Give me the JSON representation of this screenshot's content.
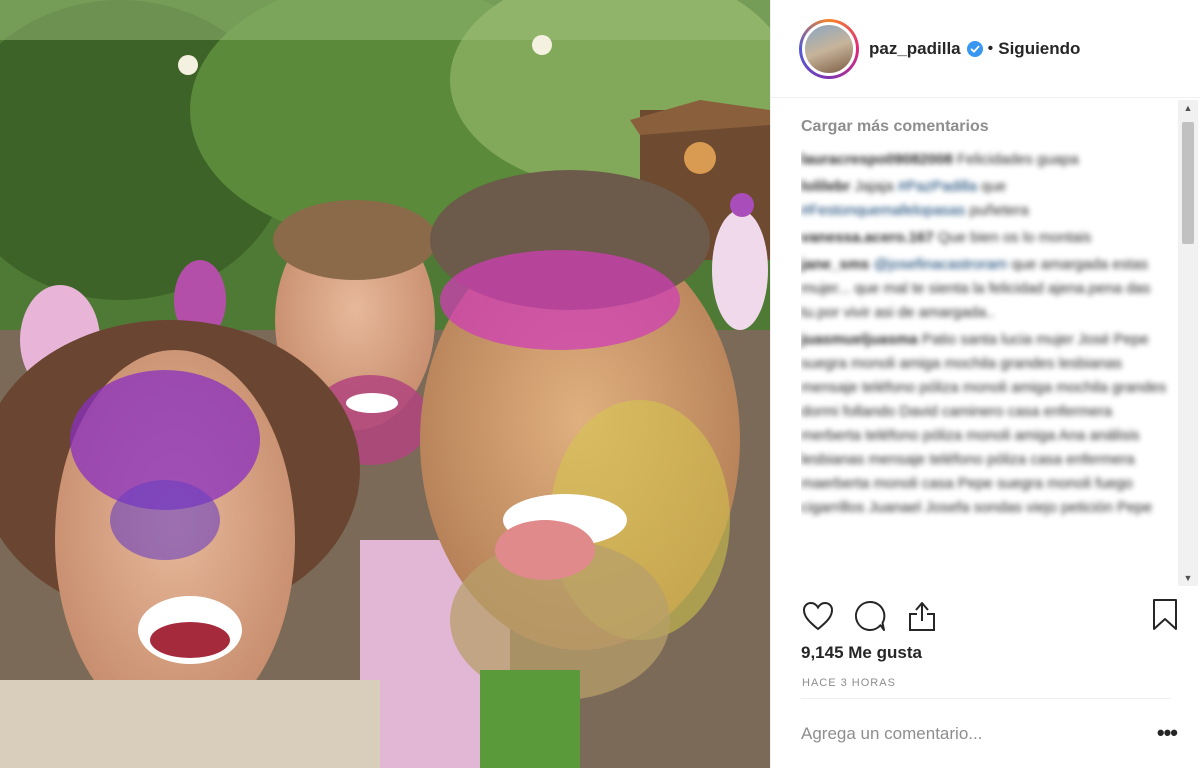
{
  "post": {
    "username": "paz_padilla",
    "separator": "•",
    "follow_state": "Siguiendo"
  },
  "comments_section": {
    "load_more_label": "Cargar más comentarios",
    "comments": [
      {
        "user": "lauracrespo09082008",
        "text": "Felicidades guapa"
      },
      {
        "user": "lolilebr",
        "text": "Jajaja",
        "tag1": "#PazPadilla",
        "text2": "que",
        "tag2": "#Festonquemafelopasas",
        "text3": "puñetera"
      },
      {
        "user": "vanessa.acero.167",
        "text": "Que bien os lo montais"
      },
      {
        "user": "jane_sms",
        "tag1": "@josefinacastroram",
        "text": "que amargada estas mujer... que mal te sienta la felicidad ajena.pena das tu.por vivir asi de amargada.."
      },
      {
        "user": "juasmueljuasma",
        "text": "Patio santa lucia mujer José Pepe suegra monoli amiga mochila grandes lesbianas mensaje teléfono póliza monoli amiga mochila grandes dormi follando David caminero casa enfermera merberta teléfono póliza monoli amiga Ana análisis lesbianas mensaje teléfono póliza casa enfermera maerberta monoli casa Pepe suegra monoli fuego cigarrillos Juanael Josefa sondas viejo petición Pepe"
      }
    ]
  },
  "actions": {
    "like_icon": "heart-icon",
    "comment_icon": "comment-bubble-icon",
    "share_icon": "share-upload-icon",
    "save_icon": "bookmark-icon"
  },
  "likes_label": "9,145 Me gusta",
  "timestamp": "HACE 3 HORAS",
  "add_comment": {
    "placeholder": "Agrega un comentario...",
    "more_label": "•••"
  },
  "colors": {
    "text": "#262626",
    "muted": "#8e8e8e",
    "verified": "#3897f0",
    "link": "#003569"
  }
}
